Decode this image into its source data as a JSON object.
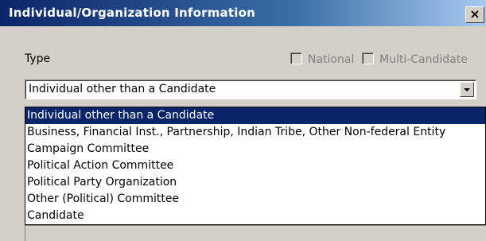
{
  "window": {
    "title": "Individual/Organization Information",
    "close_label": "×"
  },
  "form": {
    "type_label": "Type",
    "national_label": "National",
    "multi_candidate_label": "Multi-Candidate",
    "type_value": "Individual other than a Candidate"
  },
  "dropdown": {
    "options": [
      "Individual other than a Candidate",
      "Business, Financial Inst., Partnership, Indian Tribe, Other Non-federal Entity",
      "Campaign Committee",
      "Political Action Committee",
      "Political Party Organization",
      "Other (Political) Committee",
      "Candidate"
    ],
    "selected_index": 0
  },
  "colors": {
    "title_bar_start": "#0a246a",
    "title_bar_end": "#a6caf0",
    "selection": "#0a246a",
    "dialog_bg": "#d4d0c8"
  }
}
